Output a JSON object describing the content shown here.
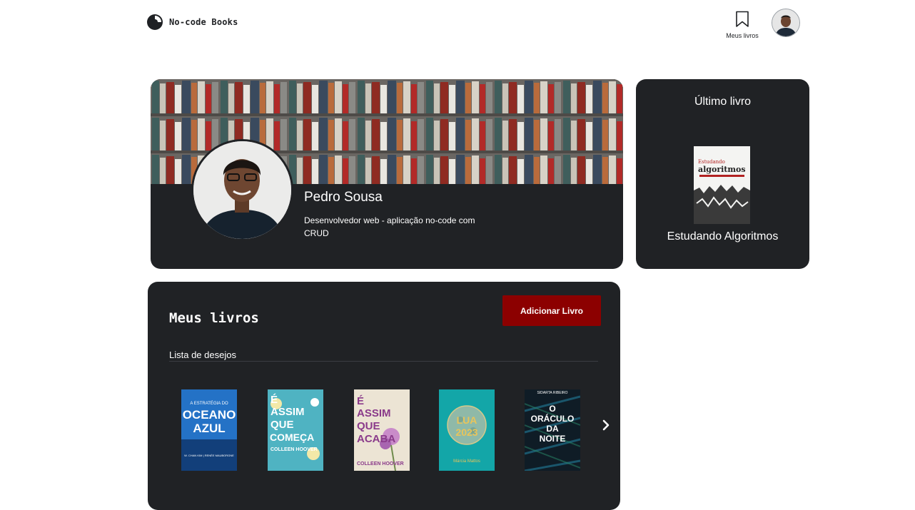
{
  "header": {
    "logo_text": "No-code Books",
    "nav_my_books": "Meus livros"
  },
  "profile": {
    "name": "Pedro Sousa",
    "bio": "Desenvolvedor web - aplicação no-code com CRUD"
  },
  "last_book": {
    "heading": "Último livro",
    "title": "Estudando Algoritmos",
    "cover_text": [
      "Estudando",
      "algoritmos"
    ]
  },
  "my_books": {
    "heading": "Meus livros",
    "add_button": "Adicionar Livro",
    "wishlist_label": "Lista de desejos",
    "covers": [
      {
        "lines": [
          "A ESTRATÉGIA DO",
          "OCEANO",
          "AZUL"
        ],
        "author": "W. CHAN KIM | RENÉE MAUBORGNE"
      },
      {
        "lines": [
          "É",
          "ASSIM",
          "QUE",
          "COMEÇA"
        ],
        "author": "COLLEEN HOOVER"
      },
      {
        "lines": [
          "É",
          "ASSIM",
          "QUE",
          "ACABA"
        ],
        "author": "COLLEEN HOOVER"
      },
      {
        "lines": [
          "LUA",
          "2023"
        ],
        "author": "Márcia Mattos"
      },
      {
        "lines": [
          "O",
          "ORÁCULO",
          "DA",
          "NOITE"
        ],
        "author": "SIDARTA RIBEIRO"
      }
    ]
  },
  "icons": {
    "logo": "logo-icon",
    "bookmark": "bookmark-icon",
    "next": "chevron-right-icon"
  },
  "colors": {
    "card_bg": "#202225",
    "accent_button": "#8c0000",
    "page_bg": "#ffffff"
  }
}
